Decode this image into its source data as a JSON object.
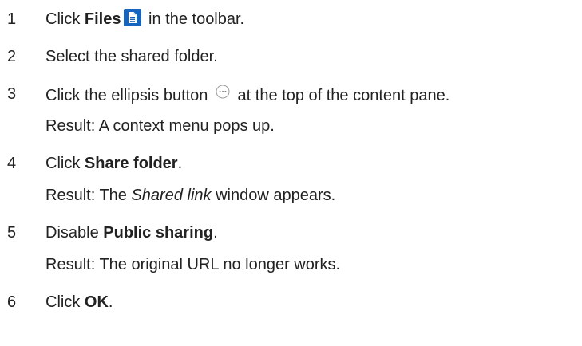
{
  "steps": [
    {
      "number": "1",
      "pre": "Click ",
      "bold": "Files",
      "post": " in the toolbar.",
      "icon": "file-document-icon"
    },
    {
      "number": "2",
      "text": "Select the shared folder."
    },
    {
      "number": "3",
      "pre": "Click the ellipsis button ",
      "post": " at the top of the content pane.",
      "icon": "ellipsis-circle-icon",
      "result": "Result: A context menu pops up."
    },
    {
      "number": "4",
      "pre": "Click ",
      "bold": "Share folder",
      "post": ".",
      "result_pre": "Result: The ",
      "result_italic": "Shared link",
      "result_post": " window appears."
    },
    {
      "number": "5",
      "pre": "Disable ",
      "bold": "Public sharing",
      "post": ".",
      "result": "Result: The original URL no longer works."
    },
    {
      "number": "6",
      "pre": "Click ",
      "bold": "OK",
      "post": "."
    }
  ],
  "colors": {
    "text": "#222222",
    "icon_blue": "#1565c0"
  }
}
